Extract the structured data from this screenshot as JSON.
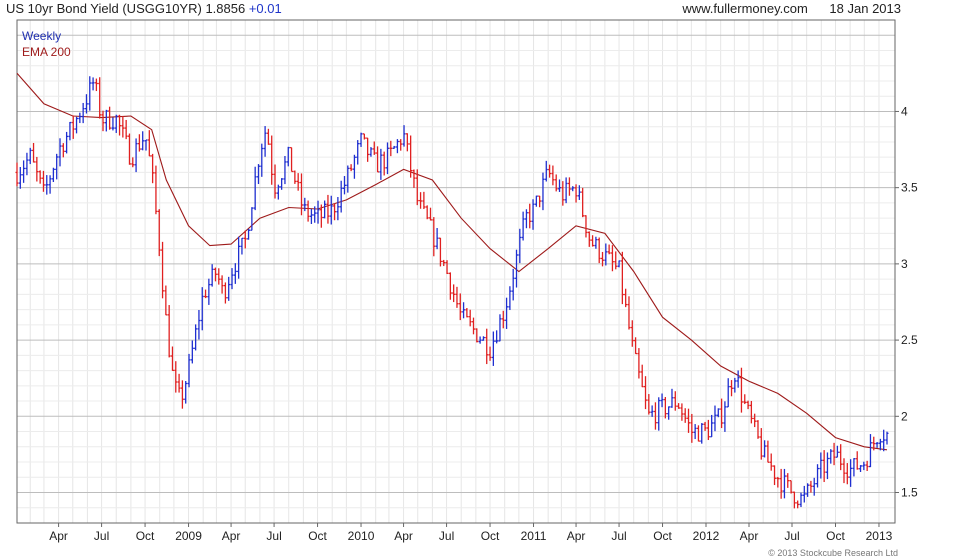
{
  "header": {
    "title": "US 10yr Bond Yield (USGG10YR)",
    "last": "1.8856",
    "change": "+0.01",
    "website": "www.fullermoney.com",
    "date": "18 Jan 2013"
  },
  "copyright": "© 2013 Stockcube Research Ltd",
  "colors": {
    "up": "#1f2fd0",
    "down": "#e02020",
    "ema": "#9e1a1a",
    "legend_weekly": "#1f2fb0",
    "legend_ema": "#9e1a1a"
  },
  "chart_data": {
    "type": "line",
    "title": "US 10yr Bond Yield (USGG10YR)",
    "legend": [
      "Weekly",
      "EMA 200"
    ],
    "legend_position": "top-left",
    "grid": true,
    "y_axis_position": "right",
    "ylim": [
      1.3,
      4.6
    ],
    "y_ticks": [
      "1.5",
      "2",
      "2.5",
      "3",
      "3.5",
      "4"
    ],
    "x_ticks": [
      "Apr",
      "Jul",
      "Oct",
      "2009",
      "Apr",
      "Jul",
      "Oct",
      "2010",
      "Apr",
      "Jul",
      "Oct",
      "2011",
      "Apr",
      "Jul",
      "Oct",
      "2012",
      "Apr",
      "Jul",
      "Oct",
      "2013"
    ],
    "series": [
      {
        "name": "Weekly",
        "frequency": "weekly",
        "x": [
          "2008-01-04",
          "2008-02-01",
          "2008-03-01",
          "2008-04-01",
          "2008-05-01",
          "2008-06-01",
          "2008-06-15",
          "2008-07-01",
          "2008-08-01",
          "2008-09-01",
          "2008-10-01",
          "2008-10-15",
          "2008-11-01",
          "2008-11-15",
          "2008-12-01",
          "2008-12-15",
          "2009-01-01",
          "2009-02-01",
          "2009-03-01",
          "2009-03-15",
          "2009-04-01",
          "2009-05-01",
          "2009-06-01",
          "2009-06-15",
          "2009-07-01",
          "2009-08-01",
          "2009-09-01",
          "2009-10-01",
          "2009-11-01",
          "2009-12-01",
          "2010-01-01",
          "2010-02-01",
          "2010-03-01",
          "2010-04-01",
          "2010-05-01",
          "2010-06-01",
          "2010-07-01",
          "2010-08-01",
          "2010-09-01",
          "2010-10-01",
          "2010-11-01",
          "2010-12-01",
          "2010-12-15",
          "2011-01-01",
          "2011-02-01",
          "2011-03-01",
          "2011-04-01",
          "2011-05-01",
          "2011-06-01",
          "2011-07-01",
          "2011-08-01",
          "2011-09-01",
          "2011-10-01",
          "2011-11-01",
          "2011-12-01",
          "2012-01-01",
          "2012-02-01",
          "2012-03-01",
          "2012-03-20",
          "2012-04-01",
          "2012-05-01",
          "2012-06-01",
          "2012-07-01",
          "2012-07-25",
          "2012-09-01",
          "2012-10-01",
          "2012-11-01",
          "2012-12-01",
          "2013-01-01",
          "2013-01-18"
        ],
        "y": [
          3.6,
          3.7,
          3.45,
          3.75,
          3.9,
          4.1,
          4.2,
          3.95,
          3.95,
          3.7,
          3.85,
          3.6,
          3.1,
          2.6,
          2.2,
          2.1,
          2.3,
          2.8,
          2.95,
          2.8,
          2.95,
          3.15,
          3.75,
          3.9,
          3.5,
          3.7,
          3.35,
          3.3,
          3.35,
          3.55,
          3.8,
          3.65,
          3.7,
          3.85,
          3.4,
          3.2,
          2.95,
          2.65,
          2.55,
          2.45,
          2.7,
          3.1,
          3.3,
          3.35,
          3.6,
          3.45,
          3.5,
          3.15,
          3.05,
          2.95,
          2.4,
          2.0,
          2.05,
          2.1,
          1.9,
          1.9,
          2.0,
          2.3,
          2.1,
          2.0,
          1.75,
          1.6,
          1.5,
          1.45,
          1.65,
          1.75,
          1.65,
          1.7,
          1.9,
          1.88
        ]
      },
      {
        "name": "EMA 200",
        "x": [
          "2008-01-04",
          "2008-03-01",
          "2008-05-01",
          "2008-07-01",
          "2008-09-01",
          "2008-10-15",
          "2008-11-15",
          "2009-01-01",
          "2009-02-15",
          "2009-04-01",
          "2009-06-01",
          "2009-08-01",
          "2009-10-01",
          "2009-12-01",
          "2010-02-01",
          "2010-04-01",
          "2010-06-01",
          "2010-08-01",
          "2010-10-01",
          "2010-12-01",
          "2011-02-01",
          "2011-04-01",
          "2011-06-01",
          "2011-08-01",
          "2011-10-01",
          "2011-12-01",
          "2012-02-01",
          "2012-04-01",
          "2012-06-01",
          "2012-08-01",
          "2012-10-01",
          "2012-12-01",
          "2013-01-18"
        ],
        "y": [
          4.25,
          4.05,
          3.97,
          3.96,
          3.97,
          3.88,
          3.55,
          3.25,
          3.12,
          3.13,
          3.3,
          3.37,
          3.36,
          3.42,
          3.52,
          3.62,
          3.55,
          3.3,
          3.1,
          2.95,
          3.1,
          3.25,
          3.2,
          2.95,
          2.65,
          2.5,
          2.33,
          2.23,
          2.15,
          2.02,
          1.86,
          1.8,
          1.78
        ]
      }
    ]
  }
}
